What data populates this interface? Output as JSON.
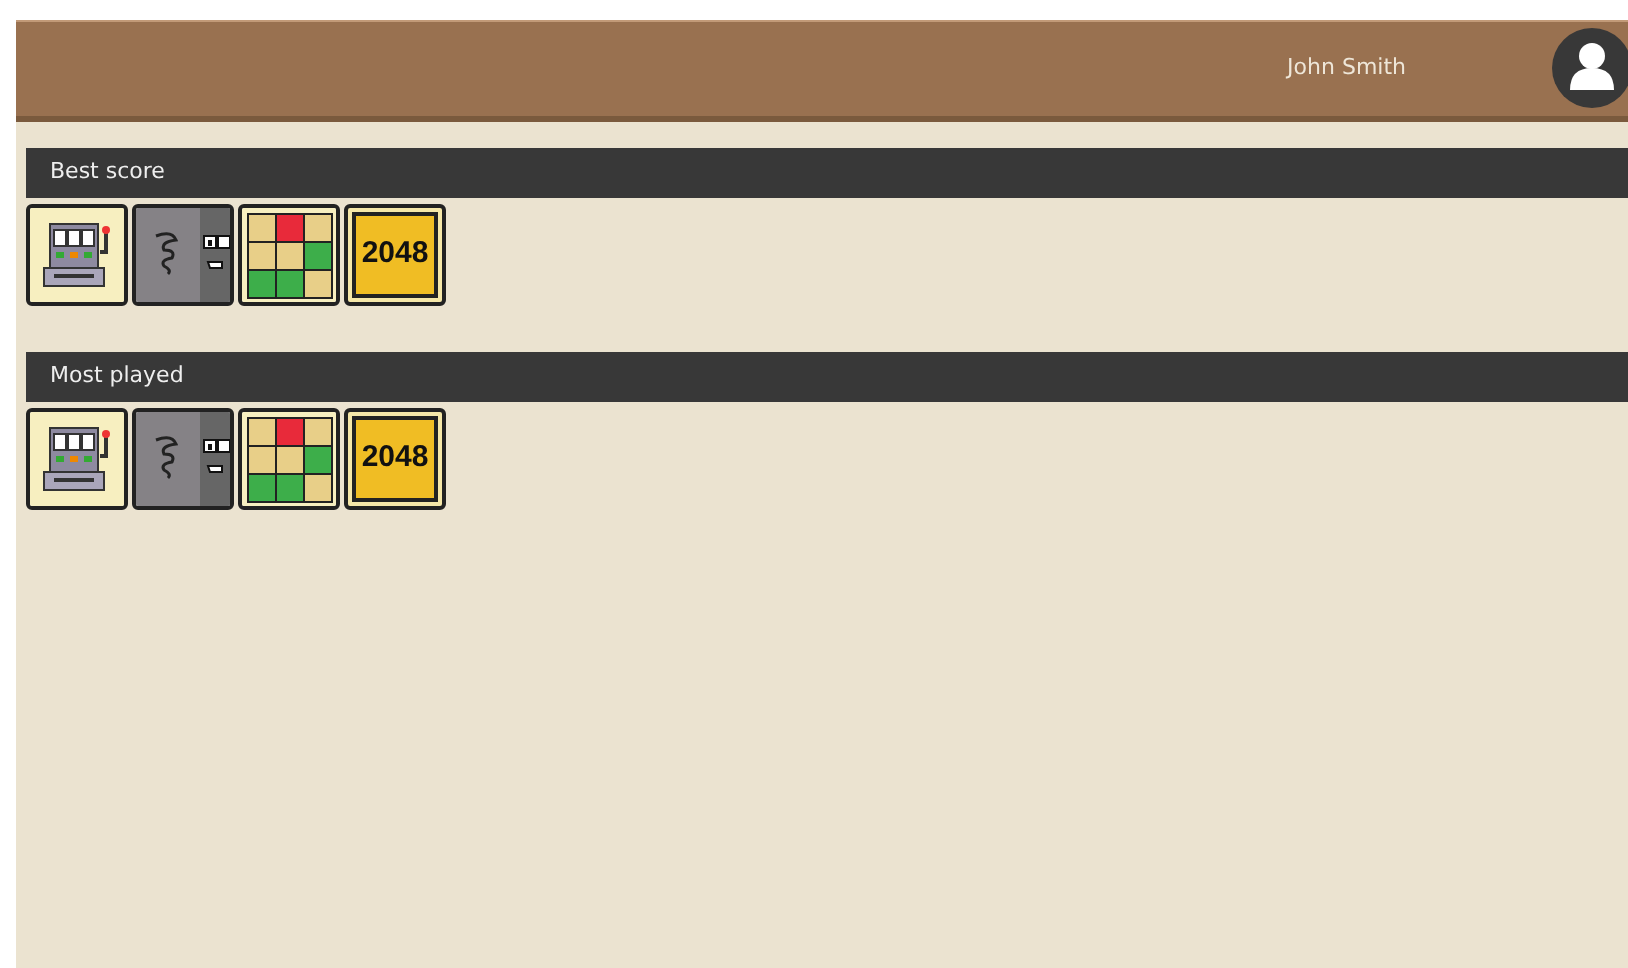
{
  "header": {
    "user_name": "John Smith"
  },
  "sections": [
    {
      "title": "Best score",
      "games": [
        {
          "kind": "slots"
        },
        {
          "kind": "face"
        },
        {
          "kind": "grid"
        },
        {
          "kind": "number",
          "label": "2048"
        }
      ]
    },
    {
      "title": "Most played",
      "games": [
        {
          "kind": "slots"
        },
        {
          "kind": "face"
        },
        {
          "kind": "grid"
        },
        {
          "kind": "number",
          "label": "2048"
        }
      ]
    }
  ]
}
